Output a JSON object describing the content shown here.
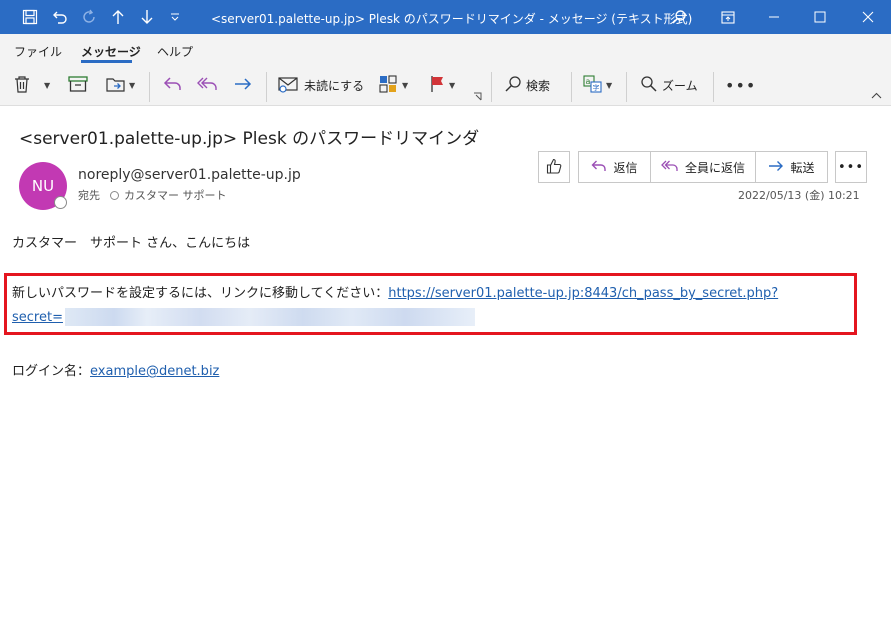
{
  "window": {
    "title": "<server01.palette-up.jp> Plesk のパスワードリマインダ  -  メッセージ (テキスト形式)"
  },
  "menu": {
    "tabs": [
      "ファイル",
      "メッセージ",
      "ヘルプ"
    ],
    "active": "メッセージ"
  },
  "ribbon": {
    "mark_unread": "未読にする",
    "search": "検索",
    "zoom": "ズーム"
  },
  "email": {
    "subject": "<server01.palette-up.jp> Plesk のパスワードリマインダ",
    "avatar_initials": "NU",
    "sender": "noreply@server01.palette-up.jp",
    "to_label": "宛先",
    "recipient": "カスタマー  サポート",
    "date": "2022/05/13 (金) 10:21",
    "actions": {
      "reply": "返信",
      "reply_all": "全員に返信",
      "forward": "転送"
    },
    "body": {
      "greeting": "カスタマー　サポート さん、こんにちは",
      "reset_text": "新しいパスワードを設定するには、リンクに移動してください：",
      "reset_link_part1": "https://server01.palette-up.jp:8443/ch_pass_by_secret.php?",
      "reset_link_part2": "secret=",
      "login_label": "ログイン名：",
      "login_value": "example@denet.biz"
    }
  },
  "colors": {
    "titlebar": "#2b6cc4",
    "avatar": "#c239b3",
    "highlight_box": "#e4151f",
    "link": "#1f5fae"
  }
}
